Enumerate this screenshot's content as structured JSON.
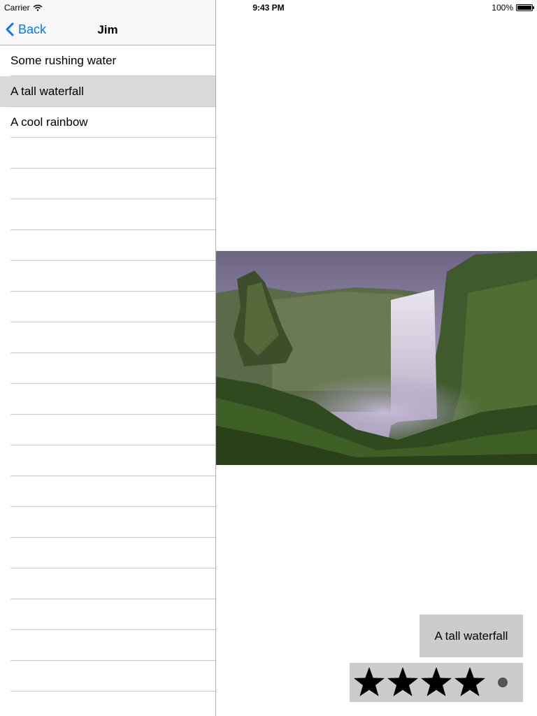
{
  "status_bar": {
    "carrier": "Carrier",
    "time": "9:43 PM",
    "battery": "100%"
  },
  "master": {
    "nav_title": "Jim",
    "back_label": "Back",
    "items": [
      {
        "label": "Some rushing water",
        "selected": false
      },
      {
        "label": "A tall waterfall",
        "selected": true
      },
      {
        "label": "A cool rainbow",
        "selected": false
      }
    ],
    "empty_rows": 19
  },
  "detail": {
    "image_subject": "waterfall",
    "caption": "A tall waterfall",
    "rating": {
      "value": 4,
      "max": 5
    }
  },
  "colors": {
    "accent": "#007aff",
    "selection": "#d9d9d9",
    "panel_gray": "#cccccc"
  }
}
